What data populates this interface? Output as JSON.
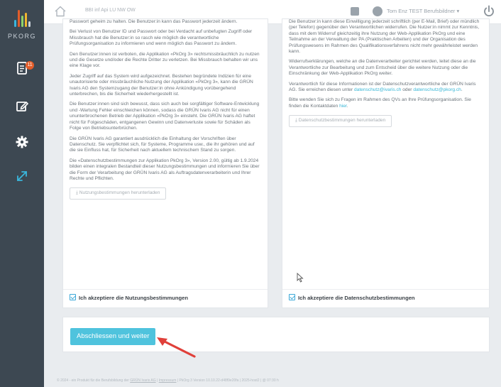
{
  "brand": {
    "logo_text": "PKORG",
    "bar_colors": [
      "#3ab6dc",
      "#e35d2a",
      "#8ed36a",
      "#f0b62e",
      "#c8d0d8"
    ]
  },
  "sidebar": {
    "items": [
      {
        "icon": "documents-icon",
        "badge": "11"
      },
      {
        "icon": "edit-icon"
      },
      {
        "icon": "gear-icon"
      },
      {
        "icon": "expand-icon"
      }
    ]
  },
  "topbar": {
    "breadcrumb": "BBI inf Api LU NW OW",
    "user_name": "Tom Enz TEST Berufsbildner ▾"
  },
  "left_panel": {
    "paragraphs": [
      "Passwort geheim zu halten. Die Benutzer:in kann das Passwort jederzeit ändern.",
      "Bei Verlust von Benutzer ID und Passwort oder bei Verdacht auf unbefugten Zugriff oder Missbrauch hat die Benutzer:in so rasch wie möglich die verantwortliche Prüfungsorganisation zu informieren und wenn möglich das Passwort zu ändern.",
      "Den Benutzer:innen ist verboten, die Applikation «PkOrg 3» rechtsmissbräuchlich zu nutzen und die Gesetze und/oder die Rechte Dritter zu verletzen. Bei Missbrauch behalten wir uns eine Klage vor.",
      "Jeder Zugriff auf das System wird aufgezeichnet. Bestehen begründete Indizien für eine unautorisierte oder missbräuchliche Nutzung der Applikation «PkOrg 3», kann die GRÜN Ivaris AG den Systemzugang der Benutzer:in ohne Ankündigung vorübergehend unterbrechen, bis die Sicherheit wiederhergestellt ist.",
      "Die Benutzer:innen sind sich bewusst, dass sich auch bei sorgfältiger Software-Entwicklung und -Wartung Fehler einschleichen können, sodass die GRÜN Ivaris AG nicht für einen ununterbrochenen Betrieb der Applikation «PkOrg 3» einsteht. Die GRÜN Ivaris AG haftet nicht für Folgeschäden, entgangenen Gewinn und Datenverluste sowie für Schäden als Folge von Betriebsunterbrüchen.",
      "Die GRÜN Ivaris AG garantiert ausdrücklich die Einhaltung der Vorschriften über Datenschutz. Sie verpflichtet sich, für Systeme, Programme usw., die ihr gehören und auf die sie Einfluss hat, für Sicherheit nach aktuellem technischem Stand zu sorgen.",
      "Die «Datenschutzbestimmungen zur Applikation PkOrg 3», Version 2.00, gültig ab 1.9.2024 bilden einen integralen Bestandteil dieser Nutzungsbestimmungen und informieren Sie über die Form der Verarbeitung der GRÜN Ivaris AG als Auftragsdatenverarbeiterin und Ihrer Rechte und Pflichten."
    ],
    "download_label": "Nutzungsbestimmungen herunterladen",
    "accept_label": "Ich akzeptiere die Nutzungsbestimmungen"
  },
  "right_panel": {
    "p1": "Die Benutzer:in kann diese Einwilligung jederzeit schriftlich (per E-Mail, Brief) oder mündlich (per Telefon) gegenüber den Verantwortlichen widerrufen. Die Nutzer:in nimmt zur Kenntnis, dass mit dem Widerruf gleichzeitig ihre Nutzung der Web-Applikation PkOrg und eine Teilnahme an der Verwaltung der PA (Praktischen Arbeiten) und der Organisation des Prüfungswesens im Rahmen des Qualifikationsverfahrens nicht mehr gewährleistet werden kann.",
    "p2": "Widerrufserklärungen, welche an die Datenverarbeiter gerichtet werden, leitet diese an die Verantwortliche zur Bearbeitung und zum Entscheid über die weitere Nutzung oder die Einschränkung der Web-Applikation PkOrg weiter.",
    "p3_before": "Verantwortlich für diese Informationen ist der Datenschutzverantwortliche der GRÜN Ivaris AG. Sie erreichen diesen unter ",
    "p3_link1": "datenschutz@ivaris.ch",
    "p3_mid": " oder ",
    "p3_link2": "datenschutz@pkorg.ch",
    "p3_after": ".",
    "p4_before": "Bitte wenden Sie sich zu Fragen im Rahmen des QVs an Ihre Prüfungsorganisation. Sie finden die Kontaktdaten ",
    "p4_link": "hier",
    "p4_after": ".",
    "download_label": "Datenschutzbestimmungen herunterladen",
    "accept_label": "Ich akzeptiere die Datenschutzbestimmungen"
  },
  "action": {
    "primary_label": "Abschliessen und weiter"
  },
  "footer": {
    "before": "© 2024 - ein Produkt für die Berufsbildung der ",
    "link1": "GRÜN Ivaris AG",
    "sep": " | ",
    "link2": "Impressum",
    "after": " | PkOrg 3 Version 10.10.22-d48f9e20fa | 2025-host2 | @ 07:30 h"
  },
  "colors": {
    "accent": "#4fc3dd",
    "sidebar": "#3d4852",
    "badge": "#e35d2a",
    "arrow": "#e0403a"
  }
}
